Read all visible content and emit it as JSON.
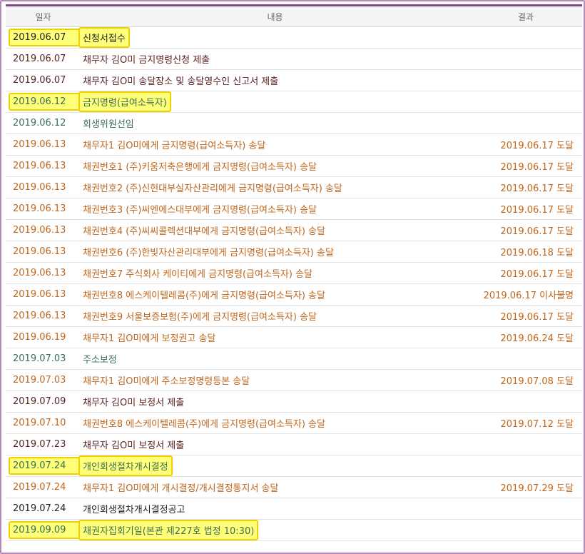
{
  "header": {
    "date": "일자",
    "content": "내용",
    "result": "결과"
  },
  "colors": {
    "black": "#222222",
    "brown": "#c0661c",
    "green": "#3a6e55",
    "darkred": "#5a1f1f"
  },
  "rows": [
    {
      "date": "2019.06.07",
      "content": "신청서접수",
      "result": "",
      "tone": "black",
      "hl": true
    },
    {
      "date": "2019.06.07",
      "content": "채무자 김O미 금지명령신청 제출",
      "result": "",
      "tone": "darkred",
      "hl": false
    },
    {
      "date": "2019.06.07",
      "content": "채무자 김O미 송달장소 및 송달영수인 신고서 제출",
      "result": "",
      "tone": "darkred",
      "hl": false
    },
    {
      "date": "2019.06.12",
      "content": "금지명령(급여소득자)",
      "result": "",
      "tone": "green",
      "hl": true
    },
    {
      "date": "2019.06.12",
      "content": "회생위원선임",
      "result": "",
      "tone": "green",
      "hl": false
    },
    {
      "date": "2019.06.13",
      "content": "채무자1 김O미에게 금지명령(급여소득자) 송달",
      "result": "2019.06.17 도달",
      "tone": "brown",
      "hl": false
    },
    {
      "date": "2019.06.13",
      "content": "채권번호1 (주)키움저축은행에게 금지명령(급여소득자) 송달",
      "result": "2019.06.17 도달",
      "tone": "brown",
      "hl": false
    },
    {
      "date": "2019.06.13",
      "content": "채권번호2 (주)신현대부실자산관리에게 금지명령(급여소득자) 송달",
      "result": "2019.06.17 도달",
      "tone": "brown",
      "hl": false
    },
    {
      "date": "2019.06.13",
      "content": "채권번호3 (주)씨엔에스대부에게 금지명령(급여소득자) 송달",
      "result": "2019.06.17 도달",
      "tone": "brown",
      "hl": false
    },
    {
      "date": "2019.06.13",
      "content": "채권번호4 (주)씨씨콜렉션대부에게 금지명령(급여소득자) 송달",
      "result": "2019.06.17 도달",
      "tone": "brown",
      "hl": false
    },
    {
      "date": "2019.06.13",
      "content": "채권번호6 (주)한빛자산관리대부에게 금지명령(급여소득자) 송달",
      "result": "2019.06.18 도달",
      "tone": "brown",
      "hl": false
    },
    {
      "date": "2019.06.13",
      "content": "채권번호7 주식회사 케이티에게 금지명령(급여소득자) 송달",
      "result": "2019.06.17 도달",
      "tone": "brown",
      "hl": false
    },
    {
      "date": "2019.06.13",
      "content": "채권번호8 에스케이텔레콤(주)에게 금지명령(급여소득자) 송달",
      "result": "2019.06.17 이사불명",
      "tone": "brown",
      "hl": false
    },
    {
      "date": "2019.06.13",
      "content": "채권번호9 서울보증보험(주)에게 금지명령(급여소득자) 송달",
      "result": "2019.06.17 도달",
      "tone": "brown",
      "hl": false
    },
    {
      "date": "2019.06.19",
      "content": "채무자1 김O미에게 보정권고 송달",
      "result": "2019.06.24 도달",
      "tone": "brown",
      "hl": false
    },
    {
      "date": "2019.07.03",
      "content": "주소보정",
      "result": "",
      "tone": "green",
      "hl": false
    },
    {
      "date": "2019.07.03",
      "content": "채무자1 김O미에게 주소보정명령등본 송달",
      "result": "2019.07.08 도달",
      "tone": "brown",
      "hl": false
    },
    {
      "date": "2019.07.09",
      "content": "채무자 김O미 보정서 제출",
      "result": "",
      "tone": "darkred",
      "hl": false
    },
    {
      "date": "2019.07.10",
      "content": "채권번호8 에스케이텔레콤(주)에게 금지명령(급여소득자) 송달",
      "result": "2019.07.12 도달",
      "tone": "brown",
      "hl": false
    },
    {
      "date": "2019.07.23",
      "content": "채무자 김O미 보정서 제출",
      "result": "",
      "tone": "darkred",
      "hl": false
    },
    {
      "date": "2019.07.24",
      "content": "개인회생절차개시결정",
      "result": "",
      "tone": "green",
      "hl": true
    },
    {
      "date": "2019.07.24",
      "content": "채무자1 김O미에게 개시결정/개시결정통지서 송달",
      "result": "2019.07.29 도달",
      "tone": "brown",
      "hl": false
    },
    {
      "date": "2019.07.24",
      "content": "개인회생절차개시결정공고",
      "result": "",
      "tone": "black",
      "hl": false
    },
    {
      "date": "2019.09.09",
      "content": "채권자집회기일(본관 제227호 법정 10:30)",
      "result": "",
      "tone": "green",
      "hl": true
    }
  ]
}
